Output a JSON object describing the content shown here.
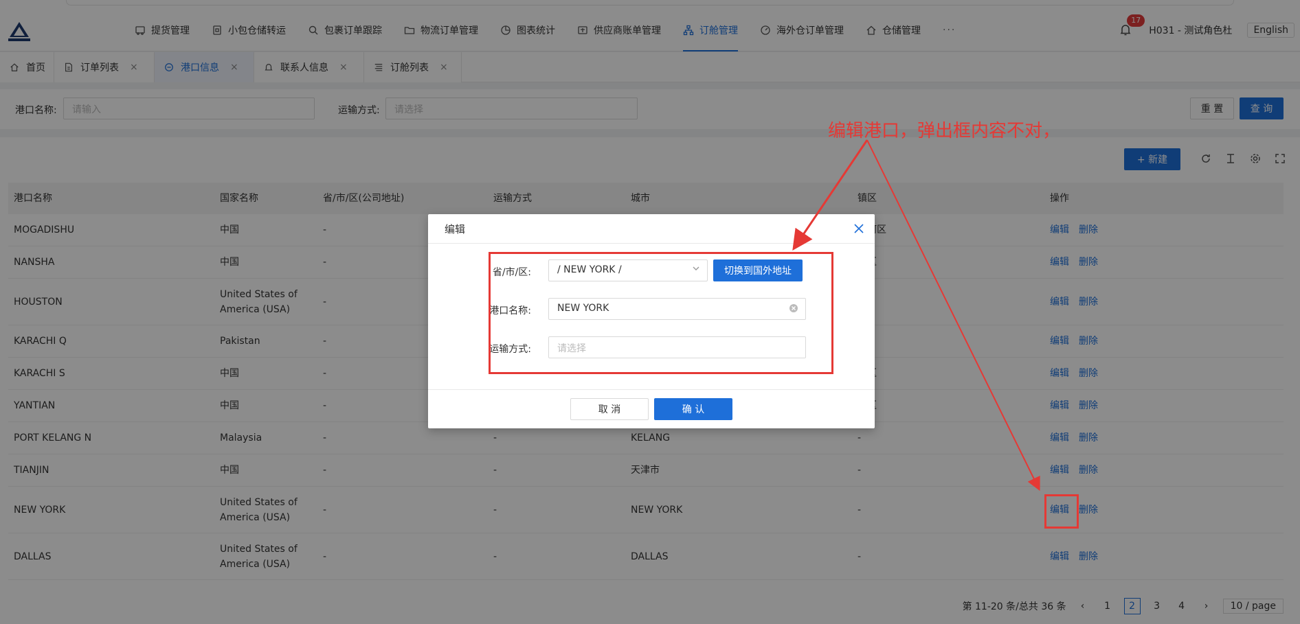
{
  "header": {
    "nav": [
      {
        "label": "提货管理",
        "icon": "truck-icon"
      },
      {
        "label": "小包仓储转运",
        "icon": "box-icon"
      },
      {
        "label": "包裹订单跟踪",
        "icon": "search-icon"
      },
      {
        "label": "物流订单管理",
        "icon": "folder-icon"
      },
      {
        "label": "图表统计",
        "icon": "pie-chart-icon"
      },
      {
        "label": "供应商账单管理",
        "icon": "bill-icon"
      },
      {
        "label": "订舱管理",
        "icon": "tree-icon",
        "active": true
      },
      {
        "label": "海外仓订单管理",
        "icon": "gauge-icon"
      },
      {
        "label": "仓储管理",
        "icon": "home-icon"
      }
    ],
    "more": "···",
    "badge_count": "17",
    "user": "H031 - 测试角色杜",
    "lang": "English"
  },
  "tabs": [
    {
      "label": "首页",
      "icon": "home-icon"
    },
    {
      "label": "订单列表",
      "icon": "doc-icon",
      "closable": true
    },
    {
      "label": "港口信息",
      "icon": "clock-icon",
      "closable": true,
      "active": true
    },
    {
      "label": "联系人信息",
      "icon": "bell-icon",
      "closable": true
    },
    {
      "label": "订舱列表",
      "icon": "list-icon",
      "closable": true
    }
  ],
  "search": {
    "port_label": "港口名称:",
    "port_placeholder": "请输入",
    "transport_label": "运输方式:",
    "transport_placeholder": "请选择",
    "reset": "重 置",
    "query": "查 询"
  },
  "toolbar": {
    "new_label": "+ 新建"
  },
  "table": {
    "headers": [
      "港口名称",
      "国家名称",
      "省/市/区(公司地址)",
      "运输方式",
      "城市",
      "镇区",
      "操作"
    ],
    "rows": [
      [
        "MOGADISHU",
        "中国",
        "-",
        "",
        "",
        "城河区",
        ""
      ],
      [
        "NANSHA",
        "中国",
        "-",
        "",
        "",
        "沙区",
        ""
      ],
      [
        "HOUSTON",
        "United States of America (USA)",
        "-",
        "",
        "",
        "",
        ""
      ],
      [
        "KARACHI Q",
        "Pakistan",
        "-",
        "",
        "",
        "",
        ""
      ],
      [
        "KARACHI S",
        "中国",
        "-",
        "",
        "",
        "白区",
        ""
      ],
      [
        "YANTIAN",
        "中国",
        "-",
        "",
        "",
        "田区",
        ""
      ],
      [
        "PORT KELANG N",
        "Malaysia",
        "-",
        "-",
        "KELANG",
        "-",
        ""
      ],
      [
        "TIANJIN",
        "中国",
        "-",
        "-",
        "天津市",
        "-",
        ""
      ],
      [
        "NEW YORK",
        "United States of America (USA)",
        "-",
        "-",
        "NEW YORK",
        "-",
        ""
      ],
      [
        "DALLAS",
        "United States of America (USA)",
        "-",
        "-",
        "DALLAS",
        "-",
        ""
      ]
    ],
    "edit": "编辑",
    "delete": "删除"
  },
  "pager": {
    "summary": "第 11-20 条/总共 36 条",
    "pages": [
      "1",
      "2",
      "3",
      "4"
    ],
    "current": "2",
    "size": "10 / page"
  },
  "modal": {
    "title": "编辑",
    "region_label": "省/市/区:",
    "region_value": "/ NEW YORK /",
    "switch_button": "切换到国外地址",
    "port_label": "港口名称:",
    "port_value": "NEW YORK",
    "transport_label": "运输方式:",
    "transport_placeholder": "请选择",
    "cancel": "取 消",
    "confirm": "确 认"
  },
  "annotation": {
    "text": "编辑港口，弹出框内容不对，"
  },
  "colors": {
    "primary": "#1e6fd9",
    "annotation_red": "#e53935"
  }
}
